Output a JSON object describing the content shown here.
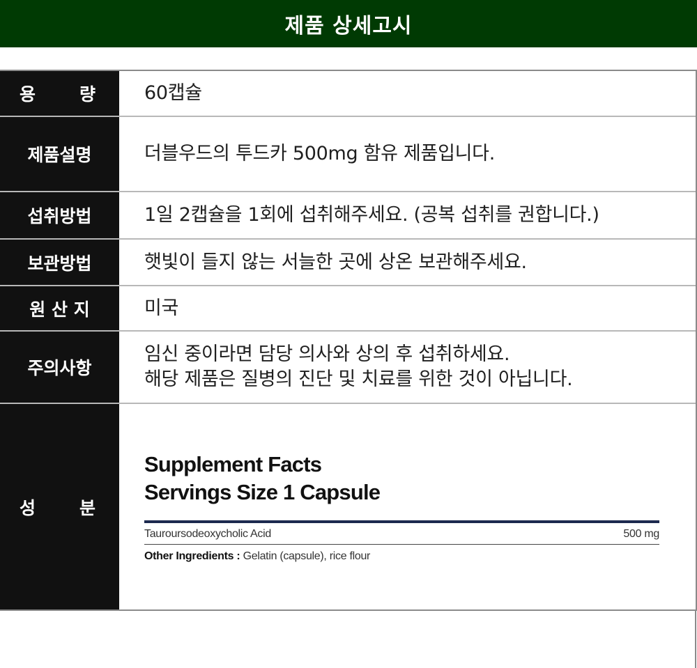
{
  "header": {
    "title": "제품 상세고시"
  },
  "rows": [
    {
      "label_a": "용",
      "label_b": "량",
      "lines": [
        "60캡슐"
      ]
    },
    {
      "label": "제품설명",
      "lines": [
        "더블우드의 투드카 500mg 함유 제품입니다."
      ]
    },
    {
      "label": "섭취방법",
      "lines": [
        "1일 2캡슐을 1회에 섭취해주세요. (공복 섭취를 권합니다.)"
      ]
    },
    {
      "label": "보관방법",
      "lines": [
        "햇빛이 들지 않는 서늘한 곳에 상온 보관해주세요."
      ]
    },
    {
      "label": "원 산 지",
      "lines": [
        "미국"
      ]
    },
    {
      "label": "주의사항",
      "lines": [
        "임신 중이라면 담당 의사와 상의 후 섭취하세요.",
        "해당 제품은 질병의 진단 및 치료를 위한 것이 아닙니다."
      ]
    },
    {
      "label_a": "성",
      "label_b": "분"
    }
  ],
  "supplement_facts": {
    "title_line1": "Supplement Facts",
    "title_line2": "Servings Size 1 Capsule",
    "ingredient_name": "Tauroursodeoxycholic Acid",
    "ingredient_amount": "500 mg",
    "other_label": "Other Ingredients :",
    "other_value": " Gelatin (capsule), rice flour"
  }
}
